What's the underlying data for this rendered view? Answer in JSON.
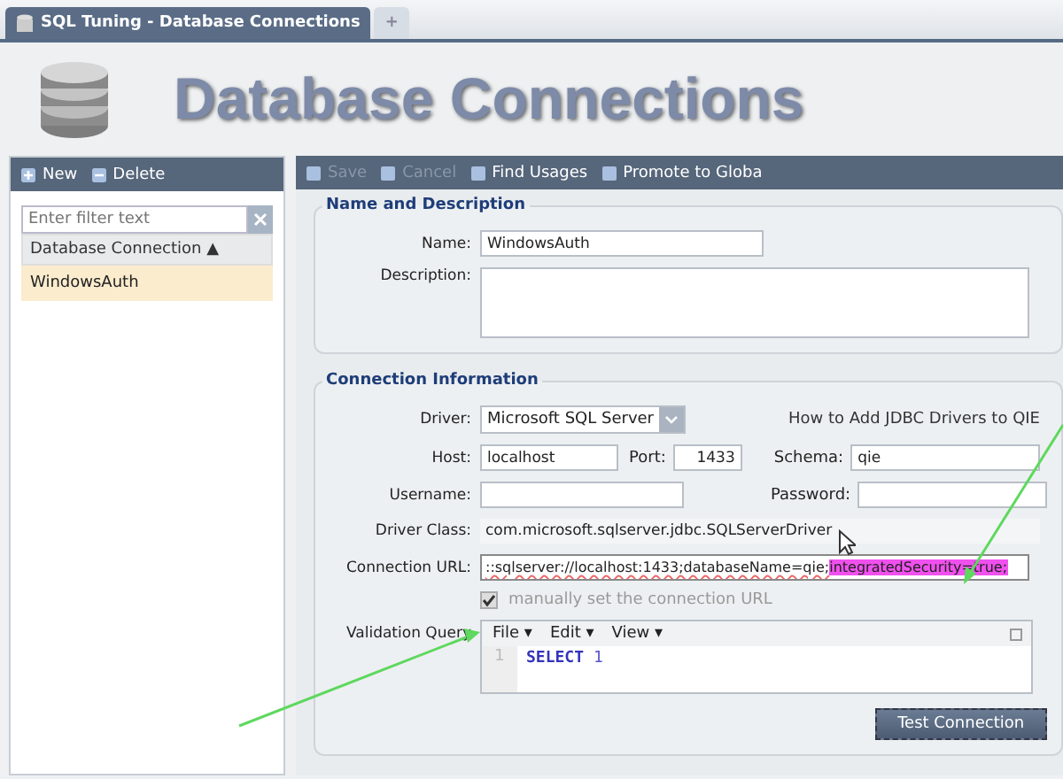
{
  "tabs": [
    {
      "label": "SQL Tuning - Database Connections",
      "selected": true
    },
    {
      "label": "+",
      "selected": false
    }
  ],
  "header": {
    "title": "Database Connections"
  },
  "sidebar": {
    "toolbar": [
      {
        "label": "New",
        "kind": "add"
      },
      {
        "label": "Delete",
        "kind": "remove"
      }
    ],
    "filter": {
      "placeholder": "Enter filter text"
    },
    "column": "Database Connection ▲",
    "items": [
      {
        "label": "WindowsAuth",
        "selected": true
      }
    ]
  },
  "toolbar": [
    {
      "label": "Save",
      "disabled": true
    },
    {
      "label": "Cancel",
      "disabled": true
    },
    {
      "label": "Find Usages",
      "disabled": false
    },
    {
      "label": "Promote to Globa",
      "disabled": false
    }
  ],
  "name_group": {
    "legend": "Name and Description",
    "name_label": "Name:",
    "name_value": "WindowsAuth",
    "description_label": "Description:"
  },
  "connection_group": {
    "legend": "Connection Information",
    "driver_label": "Driver:",
    "driver_value": "Microsoft SQL Server",
    "driver_link": "How to Add JDBC Drivers to QIE",
    "host_label": "Host:",
    "host_value": "localhost",
    "port_label": "Port:",
    "port_value": "1433",
    "schema_label": "Schema:",
    "schema_value": "qie",
    "username_label": "Username:",
    "password_label": "Password:",
    "driver_class_label": "Driver Class:",
    "driver_class_value": "com.microsoft.sqlserver.jdbc.SQLServerDriver",
    "url_label": "Connection URL:",
    "url_parts": [
      {
        "text": "::sqlserver://localhost:1433;databaseName=qie;",
        "highlighted": false
      },
      {
        "text": "integratedSecurity=true;",
        "highlighted": true
      }
    ],
    "manual_url": {
      "label": "manually set the connection URL",
      "checked": true
    },
    "query_label": "Validation Query",
    "editor_menus": [
      "File ▾",
      "Edit ▾",
      "View ▾"
    ],
    "editor_lines": [
      {
        "number": "1",
        "keyword": "SELECT",
        "rest": "1"
      }
    ],
    "test_button": "Test Connection"
  }
}
